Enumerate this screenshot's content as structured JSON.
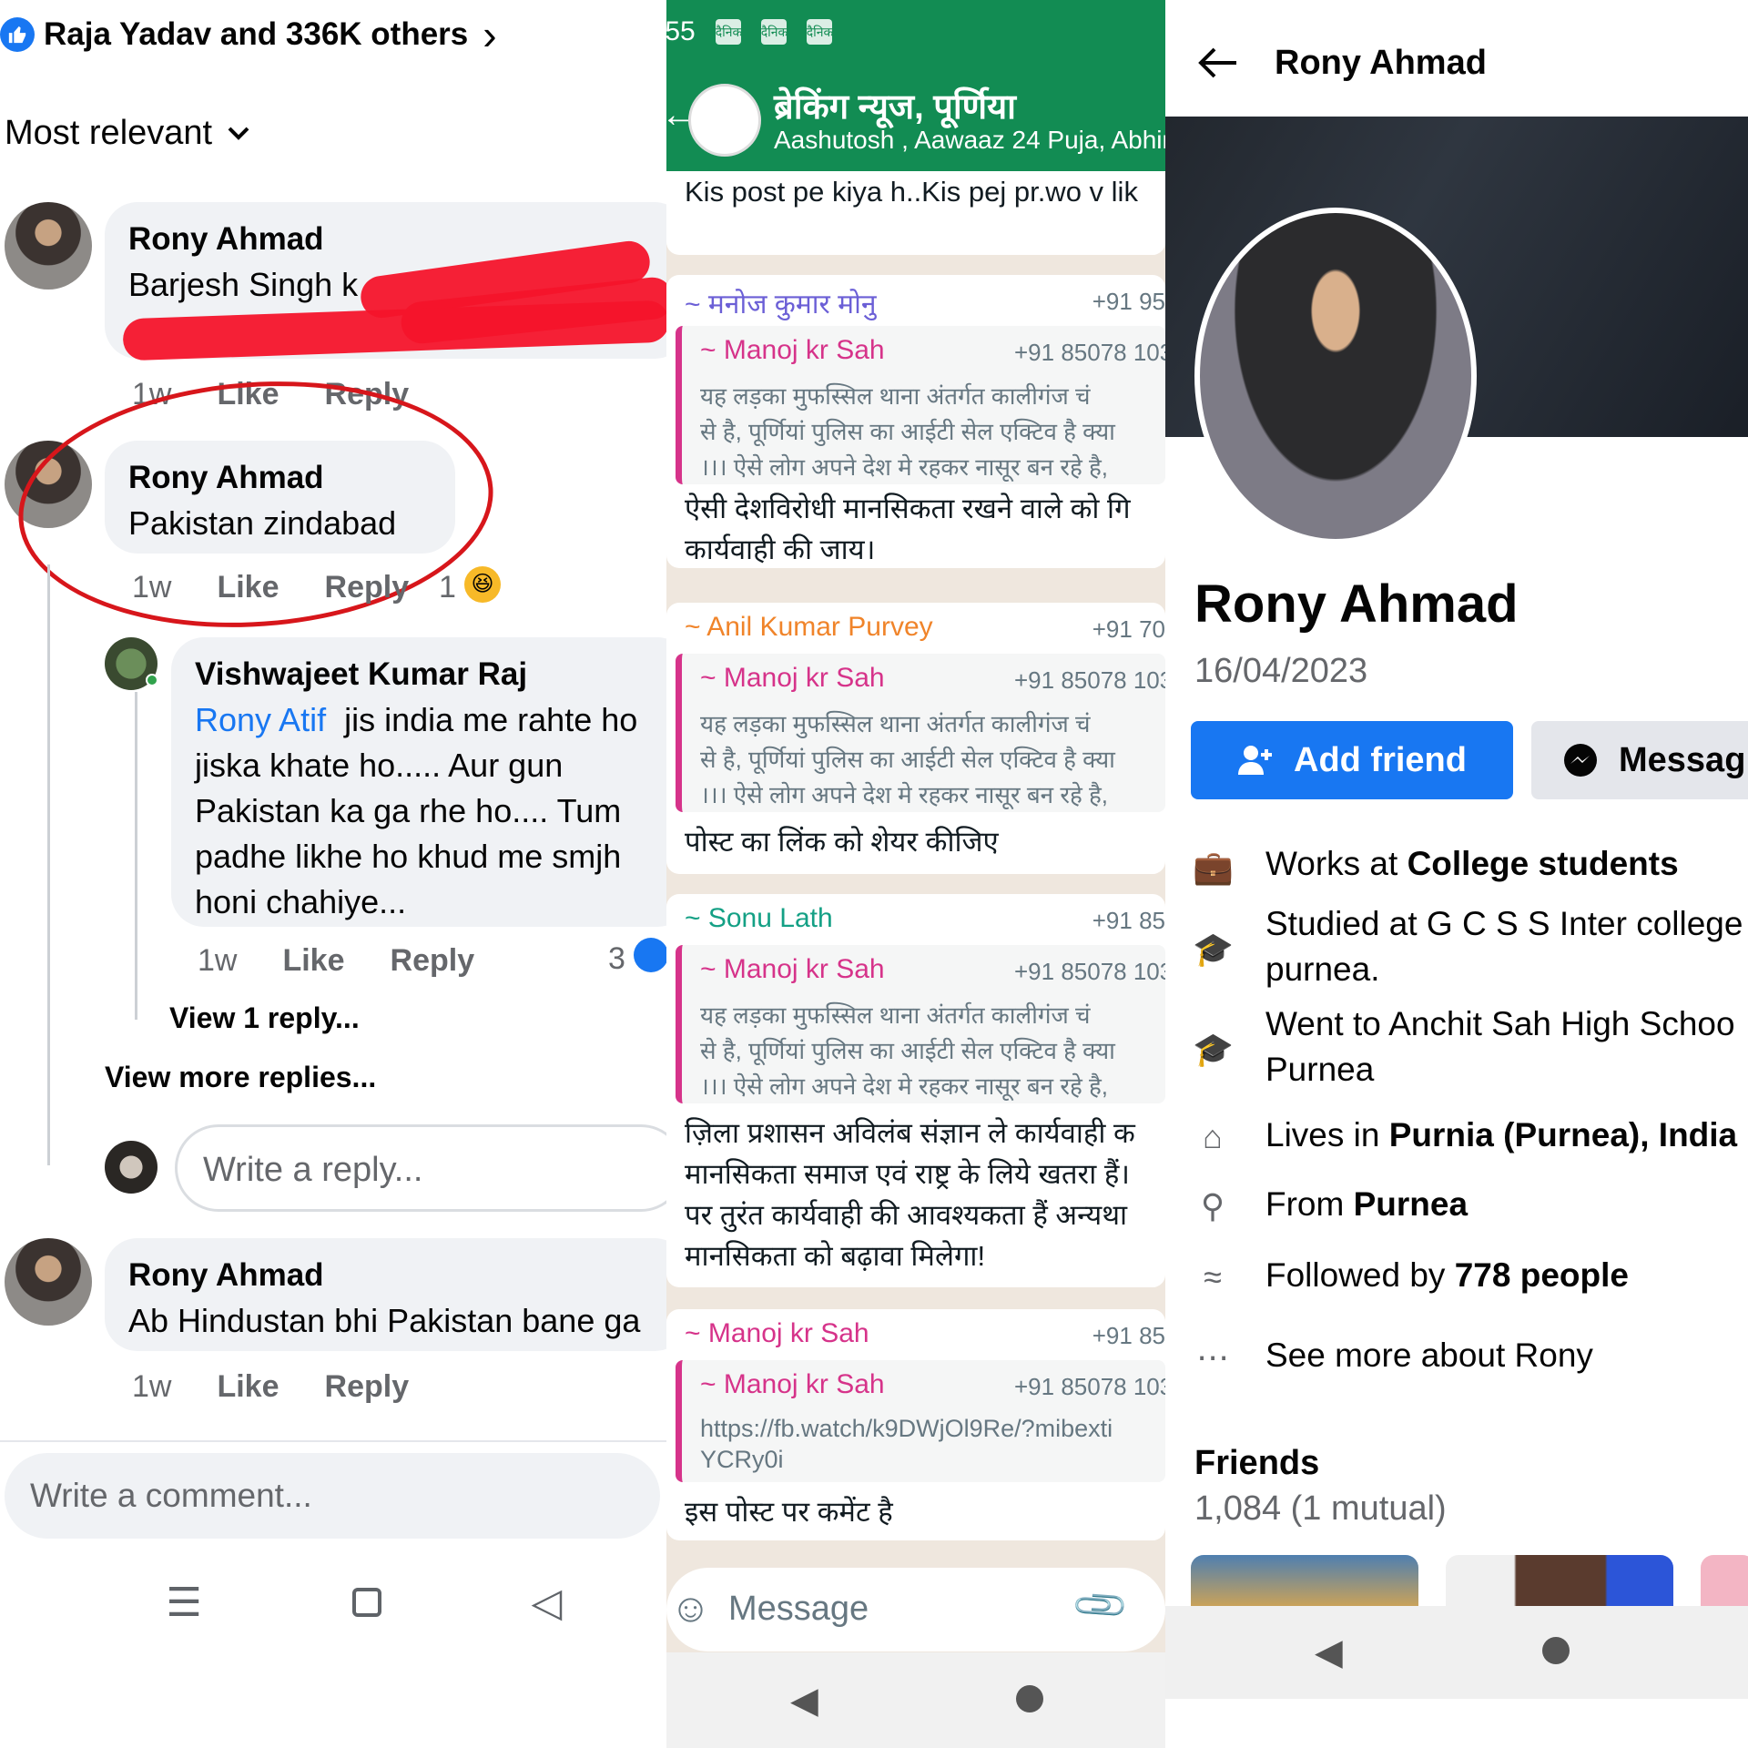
{
  "panel1": {
    "reactions_text": "Raja Yadav and 336K others",
    "sort_label": "Most relevant",
    "comments": [
      {
        "name": "Rony Ahmad",
        "text": "Barjesh Singh k",
        "time": "1w",
        "like": "Like",
        "reply": "Reply"
      },
      {
        "name": "Rony Ahmad",
        "text": "Pakistan zindabad",
        "time": "1w",
        "like": "Like",
        "reply": "Reply",
        "reaction_count": "1"
      },
      {
        "name": "Vishwajeet Kumar Raj",
        "mention": "Rony Atif",
        "lines": [
          "jis india me rahte ho",
          "jiska khate ho..... Aur gun",
          "Pakistan ka ga rhe ho.... Tum",
          "padhe likhe ho khud me smjh",
          "honi chahiye..."
        ],
        "time": "1w",
        "like": "Like",
        "reply": "Reply",
        "reaction_count": "3"
      },
      {
        "name": "Rony Ahmad",
        "text": "Ab Hindustan bhi Pakistan bane ga",
        "time": "1w",
        "like": "Like",
        "reply": "Reply"
      }
    ],
    "view_one_reply": "View 1 reply...",
    "view_more_replies": "View more replies...",
    "reply_placeholder": "Write a reply...",
    "comment_placeholder": "Write a comment..."
  },
  "panel2": {
    "status_time": ":55",
    "status_icons": [
      "दैनिक",
      "दैनिक",
      "दैनिक"
    ],
    "group_title": "ब्रेकिंग न्यूज, पूर्णिया",
    "group_members": "Aashutosh , Aawaaz 24 Puja, Abhim",
    "top_message": "Kis post pe kiya h..Kis pej pr.wo v lik",
    "quoted_name": "~ Manoj kr Sah",
    "quoted_phone": "+91 85078 103",
    "quoted_lines": [
      "यह लड़का मुफस्सिल थाना अंतर्गत कालीगंज चं",
      "से है, पूर्णियां पुलिस का आईटी सेल एक्टिव है क्या",
      "।।। ऐसे लोग अपने देश मे रहकर नासूर बन रहे है, "
    ],
    "messages": [
      {
        "sender": "~ मनोज कुमार मोनु",
        "sender_color": "#6b5fd6",
        "phone": "+91 95",
        "body": [
          "ऐसी देशविरोधी मानसिकता रखने वाले को गि",
          "कार्यवाही की जाय।"
        ]
      },
      {
        "sender": "~ Anil Kumar Purvey",
        "sender_color": "#f0842a",
        "phone": "+91 70",
        "body": [
          "पोस्ट का लिंक को शेयर कीजिए"
        ]
      },
      {
        "sender": "~ Sonu Lath",
        "sender_color": "#14a085",
        "phone": "+91 85",
        "body": [
          "ज़िला प्रशासन अविलंब संज्ञान ले कार्यवाही क",
          "मानसिकता समाज एवं राष्ट्र के लिये खतरा हैं।",
          "पर तुरंत कार्यवाही की आवश्यकता हैं अन्यथा",
          "मानसिकता को बढ़ावा मिलेगा!"
        ]
      },
      {
        "sender": "~ Manoj kr Sah",
        "sender_color": "#d6338a",
        "phone": "+91 85",
        "link_lines": [
          "https://fb.watch/k9DWjOl9Re/?mibexti",
          "YCRy0i"
        ],
        "body": [
          "इस पोस्ट पर कमेंट है"
        ]
      }
    ],
    "input_placeholder": "Message"
  },
  "panel3": {
    "header_name": "Rony Ahmad",
    "profile_name": "Rony Ahmad",
    "date": "16/04/2023",
    "add_friend_label": "Add friend",
    "message_label": "Messag",
    "details": [
      {
        "icon": "briefcase-icon",
        "prefix": "Works at ",
        "bold": "College students"
      },
      {
        "icon": "graduation-cap-icon",
        "prefix": "Studied at G C S S Inter college",
        "line2": "purnea."
      },
      {
        "icon": "graduation-cap-icon",
        "prefix": "Went to Anchit Sah High Schoo",
        "line2": "Purnea"
      },
      {
        "icon": "home-icon",
        "prefix": "Lives in ",
        "bold": "Purnia (Purnea), India"
      },
      {
        "icon": "location-pin-icon",
        "prefix": "From ",
        "bold": "Purnea"
      },
      {
        "icon": "rss-icon",
        "prefix": "Followed by ",
        "bold": "778 people"
      },
      {
        "icon": "more-icon",
        "prefix": "See more about Rony"
      }
    ],
    "friends_heading": "Friends",
    "friends_count": "1,084 (1 mutual)"
  }
}
